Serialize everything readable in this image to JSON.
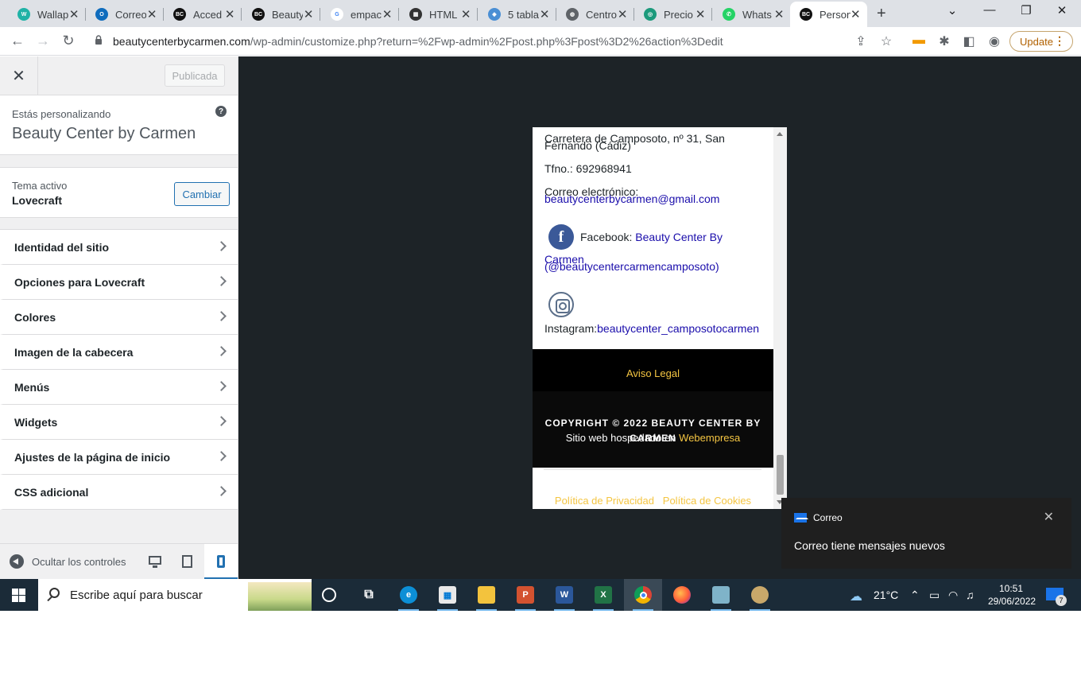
{
  "browser": {
    "tabs": [
      {
        "label": "Wallap",
        "fav": "#1fb2a6",
        "glyph": "W"
      },
      {
        "label": "Correo",
        "fav": "#0f6cbd",
        "glyph": "O"
      },
      {
        "label": "Acced",
        "fav": "#111111",
        "glyph": "BC"
      },
      {
        "label": "Beauty",
        "fav": "#111111",
        "glyph": "BC"
      },
      {
        "label": "empac",
        "fav": "#ffffff",
        "glyph": "G"
      },
      {
        "label": "HTML",
        "fav": "#333333",
        "glyph": "▦"
      },
      {
        "label": "5 tabla",
        "fav": "#4a8fd4",
        "glyph": "◆"
      },
      {
        "label": "Centro",
        "fav": "#5f6368",
        "glyph": "◍"
      },
      {
        "label": "Precio",
        "fav": "#1c9a7c",
        "glyph": "◎"
      },
      {
        "label": "Whats",
        "fav": "#25d366",
        "glyph": "✆"
      },
      {
        "label": "Person",
        "fav": "#111111",
        "glyph": "BC"
      }
    ],
    "url_domain": "beautycenterbycarmen.com",
    "url_path": "/wp-admin/customize.php?return=%2Fwp-admin%2Fpost.php%3Fpost%3D2%26action%3Dedit",
    "update_label": "Update"
  },
  "customizer": {
    "publish_label": "Publicada",
    "customizing_label": "Estás personalizando",
    "site_title": "Beauty Center by Carmen",
    "active_theme_label": "Tema activo",
    "theme_name": "Lovecraft",
    "change_label": "Cambiar",
    "sections": [
      "Identidad del sitio",
      "Opciones para Lovecraft",
      "Colores",
      "Imagen de la cabecera",
      "Menús",
      "Widgets",
      "Ajustes de la página de inicio",
      "CSS adicional"
    ],
    "hide_controls_label": "Ocultar los controles"
  },
  "preview": {
    "address_1": "Carretera de Camposoto, nº 31, San",
    "address_2": "Fernando (Cádiz)",
    "phone": "Tfno.: 692968941",
    "email_label": "Correo electrónico:",
    "email": "beautycenterbycarmen@gmail.com",
    "facebook_label": "Facebook:",
    "facebook_link_1": "Beauty Center By",
    "facebook_link_2": "Carmen",
    "facebook_handle": "(@beautycentercarmencamposoto)",
    "instagram_label": "Instagram:",
    "instagram_link": "beautycenter_camposotocarmen",
    "legal": "Aviso Legal",
    "copyright_1": "COPYRIGHT © 2022 BEAUTY CENTER BY",
    "copyright_2": "CARMEN",
    "hosted_label": "Sitio web hospedado en",
    "hosted_link": "Webempresa",
    "privacy": "Política de Privacidad",
    "cookies": "Política de Cookies"
  },
  "notification": {
    "app": "Correo",
    "message": "Correo tiene mensajes nuevos"
  },
  "taskbar": {
    "search_placeholder": "Escribe aquí para buscar",
    "weather": "21°C",
    "time": "10:51",
    "date": "29/06/2022",
    "notification_count": "7"
  }
}
